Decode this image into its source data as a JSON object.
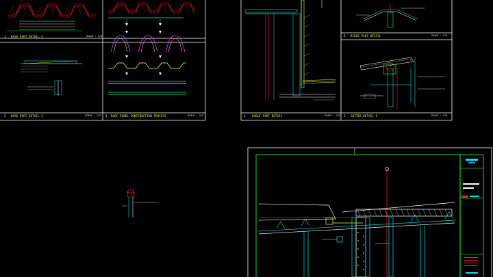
{
  "panels": [
    {
      "num": "1",
      "title": "BASE PART DETAIL-1",
      "scale": "SCALE : 1/5"
    },
    {
      "num": "2",
      "title": "BASE PART DETAIL-2",
      "scale": "SCALE : 1/5"
    },
    {
      "num": "3",
      "title": "ROOF PANEL CONSTRUCTION PROCESS",
      "scale": "SCALE : 1/5"
    },
    {
      "num": "1",
      "title": "GABLE PART DETAIL",
      "scale": "SCALE : 1/5"
    },
    {
      "num": "2",
      "title": "GUTTER DETAIL-1",
      "scale": "SCALE : 1/5"
    },
    {
      "num": "3",
      "title": "RIDGE PART DETAIL",
      "scale": "SCALE : 1/5"
    }
  ],
  "colors": {
    "background": "#000000",
    "frame": "#ffffff",
    "title": "#ffff33",
    "roof_red": "#ff2020",
    "insulation_yellow": "#ffff33",
    "panel_cyan": "#00e5ee",
    "magenta": "#ff33ff",
    "sheet_green": "#33ff33",
    "dim_gray": "#9a9a9a"
  }
}
